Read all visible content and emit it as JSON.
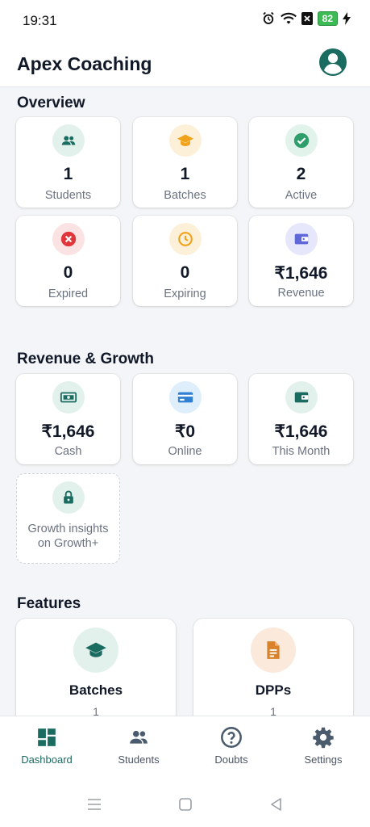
{
  "status": {
    "time": "19:31",
    "battery": "82"
  },
  "app": {
    "title": "Apex Coaching"
  },
  "overview": {
    "title": "Overview",
    "cards": [
      {
        "value": "1",
        "label": "Students",
        "icon": "people-icon"
      },
      {
        "value": "1",
        "label": "Batches",
        "icon": "graduation-cap-icon"
      },
      {
        "value": "2",
        "label": "Active",
        "icon": "check-circle-icon"
      },
      {
        "value": "0",
        "label": "Expired",
        "icon": "cancel-icon"
      },
      {
        "value": "0",
        "label": "Expiring",
        "icon": "clock-icon"
      },
      {
        "value": "₹1,646",
        "label": "Revenue",
        "icon": "wallet-icon"
      }
    ]
  },
  "revenue": {
    "title": "Revenue & Growth",
    "cards": [
      {
        "value": "₹1,646",
        "label": "Cash",
        "icon": "cash-icon"
      },
      {
        "value": "₹0",
        "label": "Online",
        "icon": "credit-card-icon"
      },
      {
        "value": "₹1,646",
        "label": "This Month",
        "icon": "wallet-icon"
      }
    ],
    "locked": {
      "line1": "Growth insights",
      "line2": "on Growth+",
      "icon": "lock-icon"
    }
  },
  "features": {
    "title": "Features",
    "items": [
      {
        "name": "Batches",
        "count": "1",
        "icon": "graduation-cap-icon"
      },
      {
        "name": "DPPs",
        "count": "1",
        "icon": "document-icon"
      }
    ]
  },
  "nav": {
    "items": [
      {
        "label": "Dashboard",
        "icon": "dashboard-icon"
      },
      {
        "label": "Students",
        "icon": "people-icon"
      },
      {
        "label": "Doubts",
        "icon": "question-icon"
      },
      {
        "label": "Settings",
        "icon": "gear-icon"
      }
    ]
  },
  "colors": {
    "primary": "#1a6b60",
    "green": "#2e9e6a",
    "orange": "#f0a21b",
    "red": "#e0353a",
    "purple": "#6067d8",
    "blue": "#2f7fd3"
  }
}
